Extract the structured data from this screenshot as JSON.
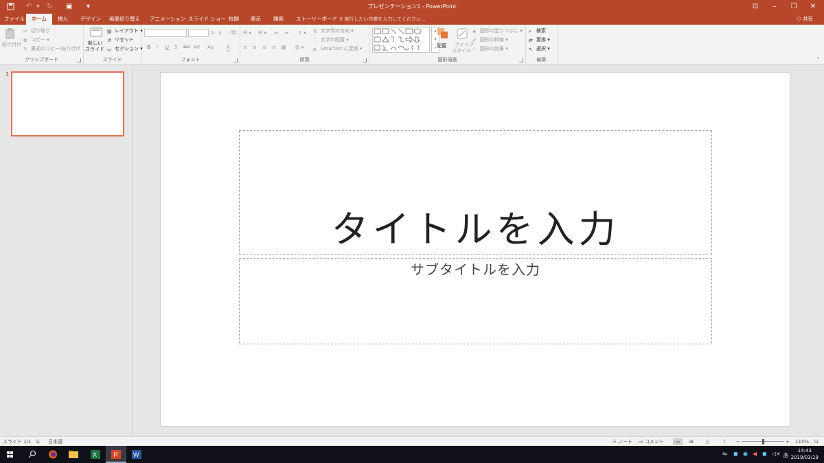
{
  "window": {
    "title": "プレゼンテーション1 - PowerPoint",
    "share_label": "共有"
  },
  "tabs": [
    "ファイル",
    "ホーム",
    "挿入",
    "デザイン",
    "画面切り替え",
    "アニメーション",
    "スライド ショー",
    "校閲",
    "表示",
    "開発",
    "ストーリーボード"
  ],
  "tell_me": "実行したい作業を入力してください...",
  "ribbon": {
    "clipboard": {
      "paste": "貼り付け",
      "cut": "切り取り",
      "copy": "コピー",
      "format_painter": "書式のコピー/貼り付け",
      "label": "クリップボード"
    },
    "slides": {
      "new_slide_1": "新しい",
      "new_slide_2": "スライド",
      "layout": "レイアウト",
      "reset": "リセット",
      "section": "セクション",
      "label": "スライド"
    },
    "font": {
      "bold": "B",
      "italic": "I",
      "underline": "U",
      "shadow": "S",
      "strike": "abc",
      "spacing": "AV",
      "case": "Aa",
      "color": "A",
      "grow": "A",
      "shrink": "A",
      "label": "フォント"
    },
    "paragraph": {
      "text_direction": "文字列の方向",
      "align_text": "文字の配置",
      "smartart": "SmartArt に変換",
      "label": "段落"
    },
    "drawing": {
      "arrange": "配置",
      "quick_styles_1": "クイック",
      "quick_styles_2": "スタイル",
      "shape_fill": "図形の塗りつぶし",
      "shape_outline": "図形の枠線",
      "shape_effects": "図形の効果",
      "label": "図形描画"
    },
    "editing": {
      "find": "検索",
      "replace": "置換",
      "select": "選択",
      "label": "編集"
    }
  },
  "thumbnails": [
    {
      "number": "1"
    }
  ],
  "slide": {
    "title_placeholder": "タイトルを入力",
    "subtitle_placeholder": "サブタイトルを入力"
  },
  "statusbar": {
    "slide_info": "スライド 1/1",
    "language": "日本語",
    "notes": "ノート",
    "comments": "コメント",
    "zoom": "115%"
  },
  "taskbar": {
    "time": "14:43",
    "date": "2019/03/19",
    "ime": "あ"
  },
  "colors": {
    "accent": "#b7472a",
    "ribbon_bg": "#f3f3f3",
    "workspace_bg": "#e6e6e6"
  }
}
